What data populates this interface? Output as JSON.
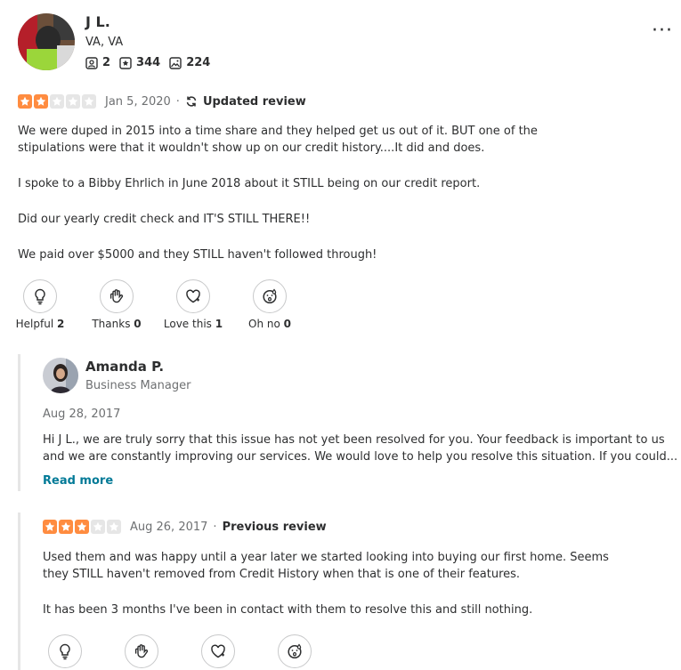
{
  "reviewer": {
    "name": "J L.",
    "location": "VA, VA",
    "friends": "2",
    "reviews": "344",
    "photos": "224"
  },
  "review": {
    "rating": 2,
    "date": "Jan 5, 2020",
    "updated_label": "Updated review",
    "paragraphs": [
      "We were duped in 2015 into a time share and they helped get us out of it. BUT one of the",
      "stipulations were that it wouldn't show up on our credit history....It did and does.",
      "I spoke to a Bibby Ehrlich in June 2018 about it STILL being on our credit report.",
      "Did our yearly credit check and IT'S STILL THERE!!",
      "We paid over $5000 and they STILL haven't followed through!"
    ],
    "reactions": [
      {
        "label": "Helpful",
        "count": "2",
        "icon": "lightbulb-icon"
      },
      {
        "label": "Thanks",
        "count": "0",
        "icon": "waving-hand-icon"
      },
      {
        "label": "Love this",
        "count": "1",
        "icon": "heart-icon"
      },
      {
        "label": "Oh no",
        "count": "0",
        "icon": "surprised-face-icon"
      }
    ]
  },
  "owner_reply": {
    "name": "Amanda P.",
    "title": "Business Manager",
    "date": "Aug 28, 2017",
    "line1": "Hi J L., we are truly sorry that this issue has not yet been resolved for you. Your feedback is important to us",
    "line2": "and we are constantly improving our services. We would love to help you resolve this situation. If you could...",
    "read_more": "Read more"
  },
  "previous_review": {
    "rating": 3,
    "date": "Aug 26, 2017",
    "label": "Previous review",
    "line1": "Used them and was happy until a year later we started looking into buying our first home. Seems",
    "line2": "they STILL haven't removed from Credit History when that is one of their features.",
    "line3": "It has been 3 months I've been in contact with them to resolve this and still nothing."
  },
  "colors": {
    "star_active": "#ff8c40",
    "star_inactive": "#e6e6e6",
    "link": "#027a97"
  }
}
